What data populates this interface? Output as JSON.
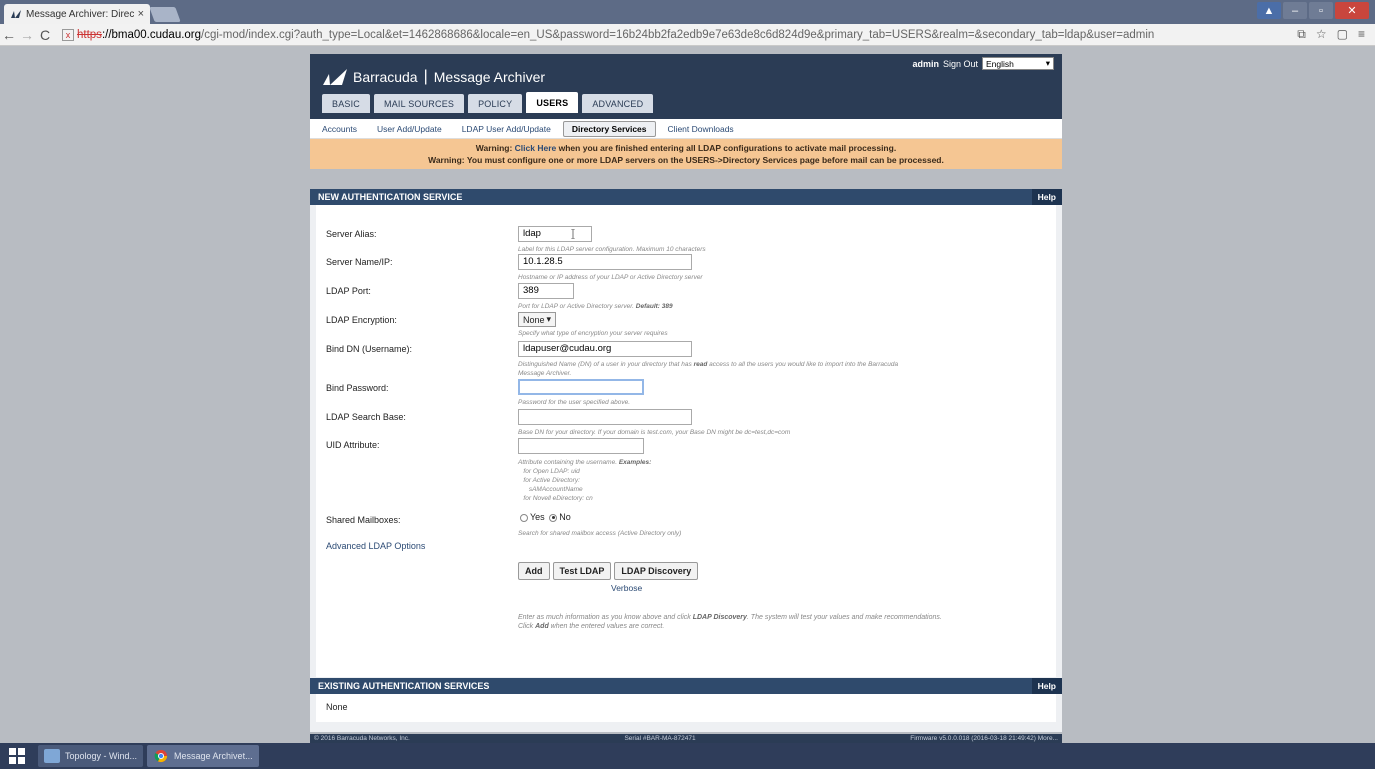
{
  "browser": {
    "tab_title": "Message Archiver: Directo",
    "tab_close": "×",
    "url_scheme": "https",
    "url_host": "://bma00.cudau.org",
    "url_path": "/cgi-mod/index.cgi?auth_type=Local&et=1462868686&locale=en_US&password=16b24bb2fa2edb9e7e63de8c6d824d9e&primary_tab=USERS&realm=&secondary_tab=ldap&user=admin",
    "back": "←",
    "forward": "→",
    "reload": "C",
    "lock_x": "x"
  },
  "header": {
    "brand": "Barracuda",
    "sep": "|",
    "product": "Message Archiver",
    "admin": "admin",
    "sign_out": "Sign Out",
    "language": "English"
  },
  "tabs": [
    {
      "label": "BASIC"
    },
    {
      "label": "MAIL SOURCES"
    },
    {
      "label": "POLICY"
    },
    {
      "label": "USERS"
    },
    {
      "label": "ADVANCED"
    }
  ],
  "subnav": [
    {
      "label": "Accounts"
    },
    {
      "label": "User Add/Update"
    },
    {
      "label": "LDAP User Add/Update"
    },
    {
      "label": "Directory Services"
    },
    {
      "label": "Client Downloads"
    }
  ],
  "warning": {
    "line1_pre": "Warning: ",
    "line1_link": "Click Here",
    "line1_post": " when you are finished entering all LDAP configurations to activate mail processing.",
    "line2": "Warning: You must configure one or more LDAP servers on the USERS->Directory Services page before mail can be processed."
  },
  "new_section": {
    "title": "NEW AUTHENTICATION SERVICE",
    "help": "Help",
    "fields": {
      "server_alias": {
        "label": "Server Alias:",
        "value": "ldap",
        "hint": "Label for this LDAP server configuration. Maximum 10 characters"
      },
      "server_name": {
        "label": "Server Name/IP:",
        "value": "10.1.28.5",
        "hint": "Hostname or IP address of your LDAP or Active Directory server"
      },
      "ldap_port": {
        "label": "LDAP Port:",
        "value": "389",
        "hint_pre": "Port for LDAP or Active Directory server. ",
        "hint_default": "Default: 389"
      },
      "encryption": {
        "label": "LDAP Encryption:",
        "value": "None",
        "hint": "Specify what type of encryption your server requires"
      },
      "bind_dn": {
        "label": "Bind DN (Username):",
        "value": "ldapuser@cudau.org",
        "hint_pre": "Distinguished Name (DN) of a user in your directory that has ",
        "hint_bold": "read",
        "hint_post": " access to all the users you would like to import into the Barracuda",
        "hint_line2": "Message Archiver."
      },
      "bind_password": {
        "label": "Bind Password:",
        "value": "",
        "hint": "Password for the user specified above."
      },
      "search_base": {
        "label": "LDAP Search Base:",
        "value": "",
        "hint": "Base DN for your directory. If your domain is test.com, your Base DN might be dc=test,dc=com"
      },
      "uid_attr": {
        "label": "UID Attribute:",
        "value": "",
        "hint_pre": "Attribute containing the username. ",
        "hint_bold": "Examples:",
        "ex1": "for Open LDAP: uid",
        "ex2": "for Active Directory:",
        "ex3": "sAMAccountName",
        "ex4": "for Novell eDirectory: cn"
      },
      "shared": {
        "label": "Shared Mailboxes:",
        "yes": "Yes",
        "no": "No",
        "hint": "Search for shared mailbox access (Active Directory only)"
      }
    },
    "advanced_link": "Advanced LDAP Options",
    "buttons": {
      "add": "Add",
      "test": "Test LDAP",
      "discovery": "LDAP Discovery"
    },
    "verbose": "Verbose",
    "info_pre": "Enter as much information as you know above and click ",
    "info_bold": "LDAP Discovery",
    "info_post": ". The system will test your values and make recommendations.",
    "info2_pre": "Click ",
    "info2_bold": "Add",
    "info2_post": " when the entered values are correct."
  },
  "existing_section": {
    "title": "EXISTING AUTHENTICATION SERVICES",
    "help": "Help",
    "none": "None"
  },
  "footer": {
    "left": "© 2016 Barracuda Networks, Inc.",
    "center": "Serial #BAR-MA-872471",
    "right": "Firmware v5.0.0.018 (2016-03-18 21:49:42) More..."
  },
  "taskbar": {
    "task1": "Topology - Wind...",
    "task2": "Message Archivet..."
  }
}
